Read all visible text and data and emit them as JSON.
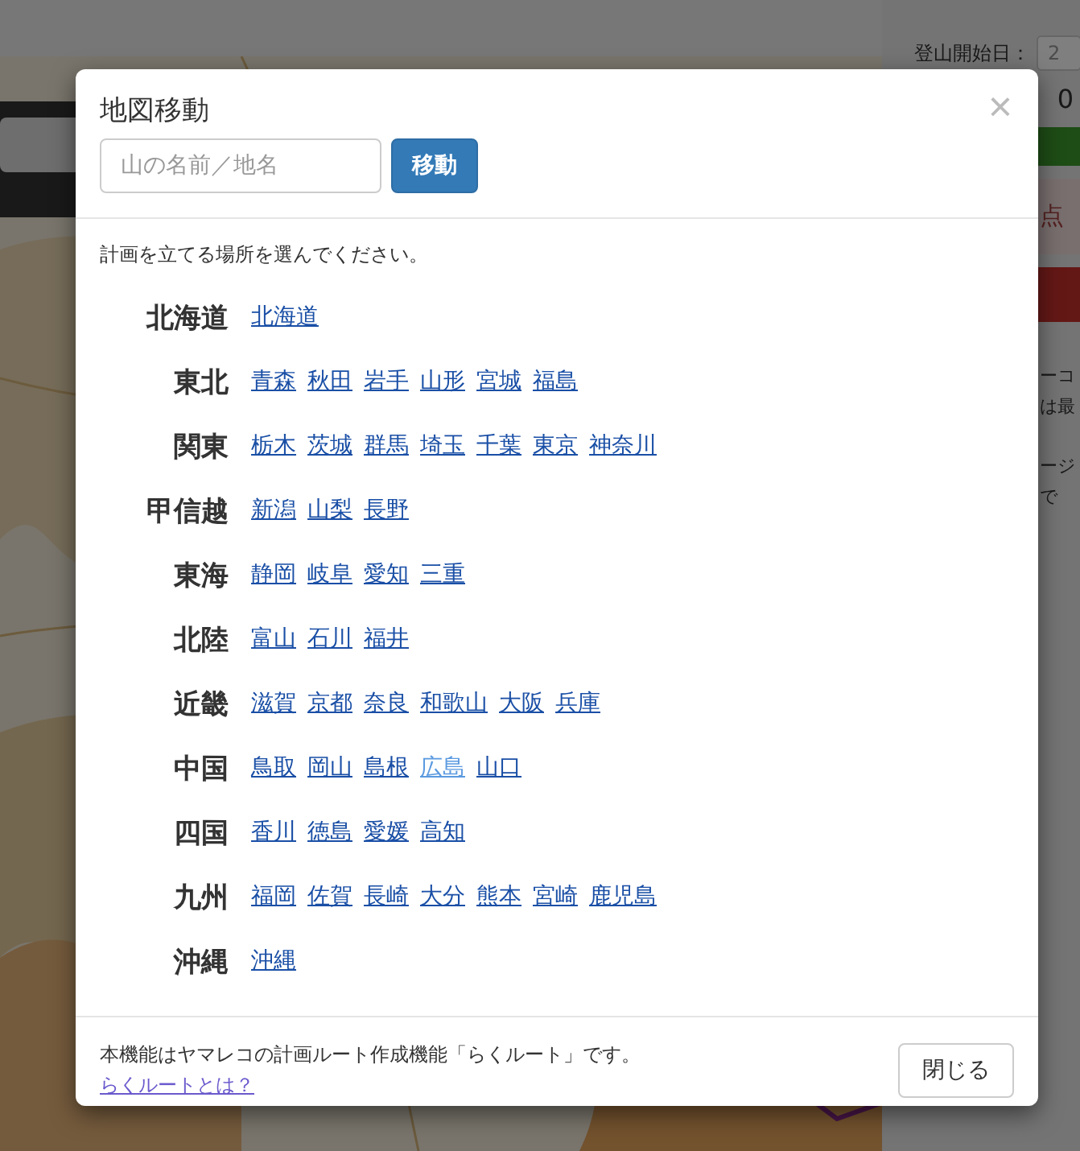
{
  "background": {
    "sidebar": {
      "start_label": "登山開始日：",
      "start_value": "2",
      "count": "0",
      "notice": "点",
      "lines": [
        "ーコ",
        "は最",
        "ージ",
        "で"
      ]
    }
  },
  "dialog": {
    "title": "地図移動",
    "close_symbol": "×",
    "search": {
      "placeholder": "山の名前／地名"
    },
    "search_button": "移動",
    "instruction": "計画を立てる場所を選んでください。",
    "regions": [
      {
        "name": "北海道",
        "prefectures": [
          {
            "name": "北海道",
            "visited": false
          }
        ]
      },
      {
        "name": "東北",
        "prefectures": [
          {
            "name": "青森",
            "visited": false
          },
          {
            "name": "秋田",
            "visited": false
          },
          {
            "name": "岩手",
            "visited": false
          },
          {
            "name": "山形",
            "visited": false
          },
          {
            "name": "宮城",
            "visited": false
          },
          {
            "name": "福島",
            "visited": false
          }
        ]
      },
      {
        "name": "関東",
        "prefectures": [
          {
            "name": "栃木",
            "visited": false
          },
          {
            "name": "茨城",
            "visited": false
          },
          {
            "name": "群馬",
            "visited": false
          },
          {
            "name": "埼玉",
            "visited": false
          },
          {
            "name": "千葉",
            "visited": false
          },
          {
            "name": "東京",
            "visited": false
          },
          {
            "name": "神奈川",
            "visited": false
          }
        ]
      },
      {
        "name": "甲信越",
        "prefectures": [
          {
            "name": "新潟",
            "visited": false
          },
          {
            "name": "山梨",
            "visited": false
          },
          {
            "name": "長野",
            "visited": false
          }
        ]
      },
      {
        "name": "東海",
        "prefectures": [
          {
            "name": "静岡",
            "visited": false
          },
          {
            "name": "岐阜",
            "visited": false
          },
          {
            "name": "愛知",
            "visited": false
          },
          {
            "name": "三重",
            "visited": false
          }
        ]
      },
      {
        "name": "北陸",
        "prefectures": [
          {
            "name": "富山",
            "visited": false
          },
          {
            "name": "石川",
            "visited": false
          },
          {
            "name": "福井",
            "visited": false
          }
        ]
      },
      {
        "name": "近畿",
        "prefectures": [
          {
            "name": "滋賀",
            "visited": false
          },
          {
            "name": "京都",
            "visited": false
          },
          {
            "name": "奈良",
            "visited": false
          },
          {
            "name": "和歌山",
            "visited": false
          },
          {
            "name": "大阪",
            "visited": false
          },
          {
            "name": "兵庫",
            "visited": false
          }
        ]
      },
      {
        "name": "中国",
        "prefectures": [
          {
            "name": "鳥取",
            "visited": false
          },
          {
            "name": "岡山",
            "visited": false
          },
          {
            "name": "島根",
            "visited": false
          },
          {
            "name": "広島",
            "visited": true
          },
          {
            "name": "山口",
            "visited": false
          }
        ]
      },
      {
        "name": "四国",
        "prefectures": [
          {
            "name": "香川",
            "visited": false
          },
          {
            "name": "徳島",
            "visited": false
          },
          {
            "name": "愛媛",
            "visited": false
          },
          {
            "name": "高知",
            "visited": false
          }
        ]
      },
      {
        "name": "九州",
        "prefectures": [
          {
            "name": "福岡",
            "visited": false
          },
          {
            "name": "佐賀",
            "visited": false
          },
          {
            "name": "長崎",
            "visited": false
          },
          {
            "name": "大分",
            "visited": false
          },
          {
            "name": "熊本",
            "visited": false
          },
          {
            "name": "宮崎",
            "visited": false
          },
          {
            "name": "鹿児島",
            "visited": false
          }
        ]
      },
      {
        "name": "沖縄",
        "prefectures": [
          {
            "name": "沖縄",
            "visited": false
          }
        ]
      }
    ],
    "footer_text": "本機能はヤマレコの計画ルート作成機能「らくルート」です。",
    "footer_link": "らくルートとは？",
    "close_button": "閉じる"
  }
}
